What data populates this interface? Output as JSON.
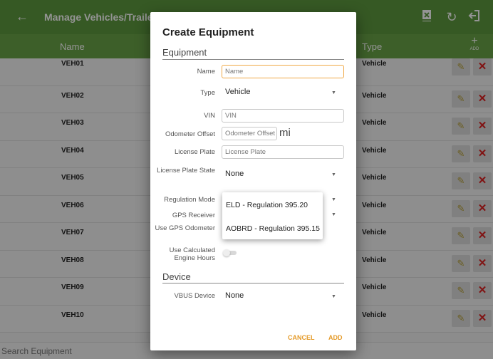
{
  "app": {
    "title": "Manage Vehicles/Trailers",
    "columns": {
      "name": "Name",
      "type": "Type",
      "add": "ADD"
    },
    "rows": [
      {
        "name": "VEH01",
        "type": "Vehicle"
      },
      {
        "name": "VEH02",
        "type": "Vehicle"
      },
      {
        "name": "VEH03",
        "type": "Vehicle"
      },
      {
        "name": "VEH04",
        "type": "Vehicle"
      },
      {
        "name": "VEH05",
        "type": "Vehicle"
      },
      {
        "name": "VEH06",
        "type": "Vehicle"
      },
      {
        "name": "VEH07",
        "type": "Vehicle"
      },
      {
        "name": "VEH08",
        "type": "Vehicle"
      },
      {
        "name": "VEH09",
        "type": "Vehicle"
      },
      {
        "name": "VEH10",
        "type": "Vehicle"
      }
    ],
    "search_placeholder": "Search Equipment",
    "icons": {
      "back": "back-arrow-icon",
      "export": "export-icon",
      "refresh": "refresh-icon",
      "logout": "logout-icon",
      "edit": "pencil-icon",
      "delete": "close-icon"
    },
    "colors": {
      "toolbar": "#5e9a3e",
      "header": "#6aa447",
      "accent": "#e59b2a",
      "delete": "#dd2222"
    }
  },
  "dialog": {
    "title": "Create Equipment",
    "section_equipment": "Equipment",
    "section_device": "Device",
    "fields": {
      "name": {
        "label": "Name",
        "placeholder": "Name"
      },
      "type": {
        "label": "Type",
        "value": "Vehicle"
      },
      "vin": {
        "label": "VIN",
        "placeholder": "VIN"
      },
      "odometer_offset": {
        "label": "Odometer Offset",
        "placeholder": "Odometer Offset",
        "unit": "mi"
      },
      "license_plate": {
        "label": "License Plate",
        "placeholder": "License Plate"
      },
      "license_plate_state": {
        "label": "License Plate State",
        "value": "None"
      },
      "regulation_mode": {
        "label": "Regulation Mode"
      },
      "gps_receiver": {
        "label": "GPS Receiver"
      },
      "use_gps_odometer": {
        "label": "Use GPS Odometer"
      },
      "use_calculated_engine_hours": {
        "label": "Use Calculated Engine Hours",
        "on": false
      },
      "vbus_device": {
        "label": "VBUS Device",
        "value": "None"
      }
    },
    "regulation_options": [
      "ELD - Regulation 395.20",
      "AOBRD - Regulation 395.15"
    ],
    "cancel": "CANCEL",
    "add": "ADD"
  }
}
